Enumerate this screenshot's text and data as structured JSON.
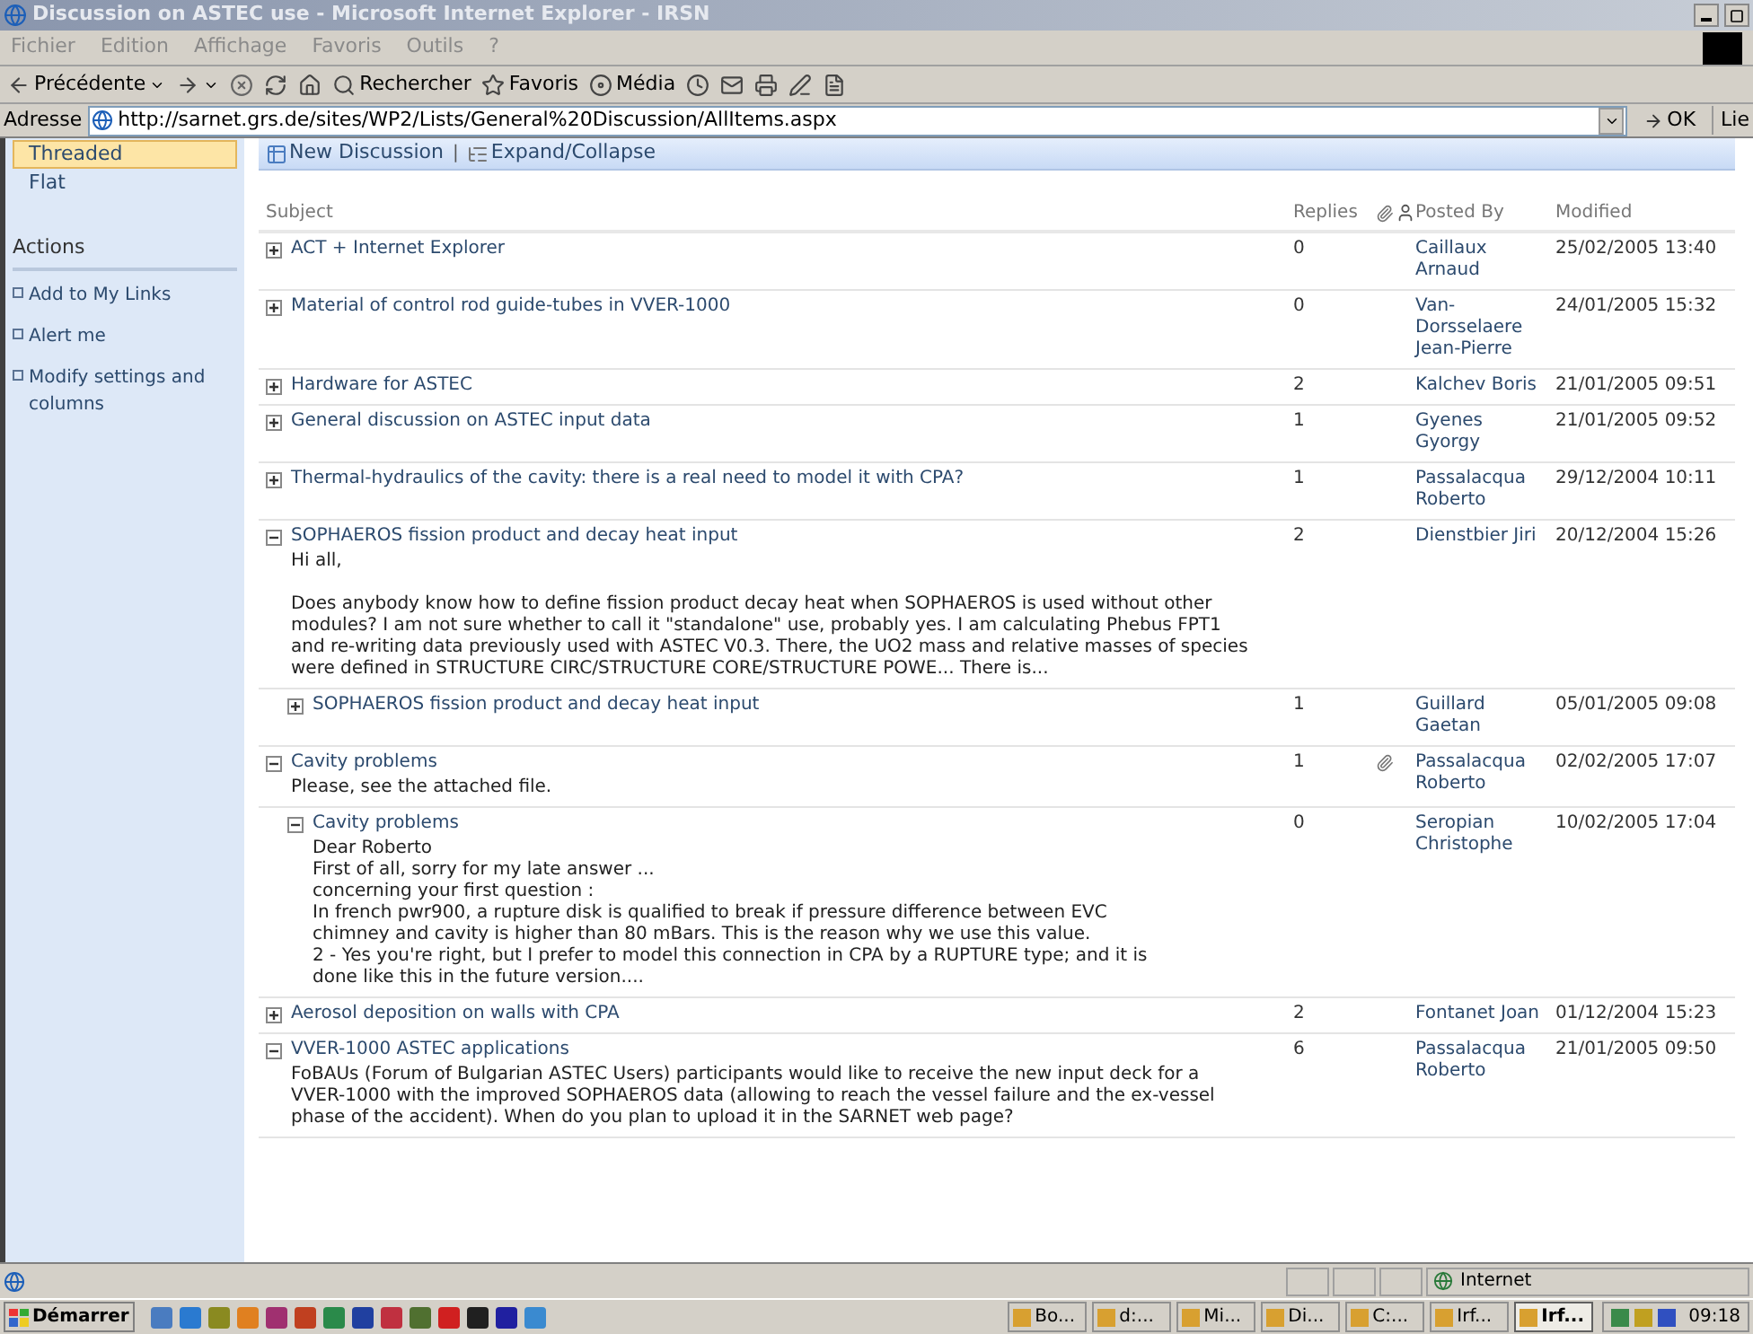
{
  "window": {
    "title": "Discussion on ASTEC use - Microsoft Internet Explorer - IRSN"
  },
  "menu": [
    "Fichier",
    "Edition",
    "Affichage",
    "Favoris",
    "Outils",
    "?"
  ],
  "toolbar": [
    {
      "kind": "back",
      "label": "Précédente"
    },
    {
      "kind": "forward"
    },
    {
      "kind": "stop"
    },
    {
      "kind": "refresh"
    },
    {
      "kind": "home"
    },
    {
      "kind": "search",
      "label": "Rechercher"
    },
    {
      "kind": "favorites",
      "label": "Favoris"
    },
    {
      "kind": "media",
      "label": "Média"
    },
    {
      "kind": "history"
    },
    {
      "kind": "mail"
    },
    {
      "kind": "print"
    },
    {
      "kind": "edit"
    },
    {
      "kind": "note"
    }
  ],
  "address": {
    "label": "Adresse",
    "url": "http://sarnet.grs.de/sites/WP2/Lists/General%20Discussion/AllItems.aspx",
    "go": "OK",
    "links": "Lie"
  },
  "sidebar": {
    "views": [
      {
        "label": "Threaded",
        "selected": true
      },
      {
        "label": "Flat",
        "selected": false
      }
    ],
    "actions_title": "Actions",
    "actions": [
      "Add to My Links",
      "Alert me",
      "Modify settings and columns"
    ]
  },
  "list_toolbar": [
    {
      "kind": "new",
      "label": "New Discussion"
    },
    {
      "kind": "separator",
      "label": "|"
    },
    {
      "kind": "expand",
      "label": "Expand/Collapse"
    }
  ],
  "table": {
    "columns": {
      "subject": "Subject",
      "replies": "Replies",
      "posted_by": "Posted By",
      "modified": "Modified"
    },
    "rows": [
      {
        "subject": "ACT + Internet Explorer",
        "expanded": false,
        "replies": "0",
        "attachment": false,
        "posted_by": "Caillaux Arnaud",
        "modified": "25/02/2005 13:40"
      },
      {
        "subject": "Material of control rod guide-tubes in VVER-1000",
        "expanded": false,
        "replies": "0",
        "attachment": false,
        "posted_by": "Van-Dorsselaere Jean-Pierre",
        "modified": "24/01/2005 15:32"
      },
      {
        "subject": "Hardware for ASTEC",
        "expanded": false,
        "replies": "2",
        "attachment": false,
        "posted_by": "Kalchev Boris",
        "modified": "21/01/2005 09:51"
      },
      {
        "subject": "General discussion on ASTEC input data",
        "expanded": false,
        "replies": "1",
        "attachment": false,
        "posted_by": "Gyenes Gyorgy",
        "modified": "21/01/2005 09:52"
      },
      {
        "subject": "Thermal-hydraulics of the cavity: there is a real need to model it with CPA?",
        "expanded": false,
        "replies": "1",
        "attachment": false,
        "posted_by": "Passalacqua Roberto",
        "modified": "29/12/2004 10:11"
      },
      {
        "subject": "SOPHAEROS fission product and decay heat input",
        "expanded": true,
        "replies": "2",
        "attachment": false,
        "posted_by": "Dienstbier Jiri",
        "modified": "20/12/2004 15:26",
        "body": [
          [
            "Hi all,"
          ],
          [
            "Does anybody know how to define fission product decay heat when SOPHAEROS is used without other modules? I am not sure whether to call it \"standalone\" use, probably yes. I am calculating Phebus FPT1 and re-writing data previously used with ASTEC V0.3. There, the UO2 mass and relative masses of species were defined in STRUCTURE CIRC/STRUCTURE CORE/STRUCTURE POWE... There is..."
          ]
        ],
        "children": [
          {
            "subject": "SOPHAEROS fission product and decay heat input",
            "expanded": false,
            "replies": "1",
            "attachment": false,
            "posted_by": "Guillard Gaetan",
            "modified": "05/01/2005 09:08"
          }
        ]
      },
      {
        "subject": "Cavity problems",
        "expanded": true,
        "replies": "1",
        "attachment": true,
        "posted_by": "Passalacqua Roberto",
        "modified": "02/02/2005 17:07",
        "body": [
          [
            "Please, see the attached file."
          ]
        ],
        "children": [
          {
            "subject": "Cavity problems",
            "expanded": true,
            "replies": "0",
            "attachment": false,
            "posted_by": "Seropian Christophe",
            "modified": "10/02/2005 17:04",
            "body": [
              [
                "Dear Roberto",
                "First of all, sorry for my late answer ...",
                "concerning your first question :",
                "In french pwr900, a rupture disk is qualified to break if pressure difference between EVC",
                "chimney and cavity is higher than 80 mBars. This is the reason why we use this value.",
                "2 - Yes you're right, but I prefer to model this connection in CPA by a RUPTURE type; and it is",
                "done like this in the future version...."
              ]
            ]
          }
        ]
      },
      {
        "subject": "Aerosol deposition on walls with CPA",
        "expanded": false,
        "replies": "2",
        "attachment": false,
        "posted_by": "Fontanet Joan",
        "modified": "01/12/2004 15:23"
      },
      {
        "subject": "VVER-1000 ASTEC applications",
        "expanded": true,
        "replies": "6",
        "attachment": false,
        "posted_by": "Passalacqua Roberto",
        "modified": "21/01/2005 09:50",
        "body": [
          [
            "FoBAUs (Forum of Bulgarian ASTEC Users) participants would like to receive the new input deck for a VVER-1000 with the improved SOPHAEROS data (allowing to reach the vessel failure and the ex-vessel phase of the accident). When do you plan to upload it in the SARNET web page?"
          ]
        ]
      }
    ]
  },
  "status_bar": {
    "zone": "Internet"
  },
  "taskbar": {
    "start": "Démarrer",
    "tasks": [
      {
        "label": "Bo...",
        "selected": false
      },
      {
        "label": "d:...",
        "selected": false
      },
      {
        "label": "Mi...",
        "selected": false
      },
      {
        "label": "Di...",
        "selected": false
      },
      {
        "label": "C:...",
        "selected": false
      },
      {
        "label": "Irf...",
        "selected": false
      },
      {
        "label": "Irf...",
        "selected": true
      }
    ],
    "clock": "09:18"
  }
}
